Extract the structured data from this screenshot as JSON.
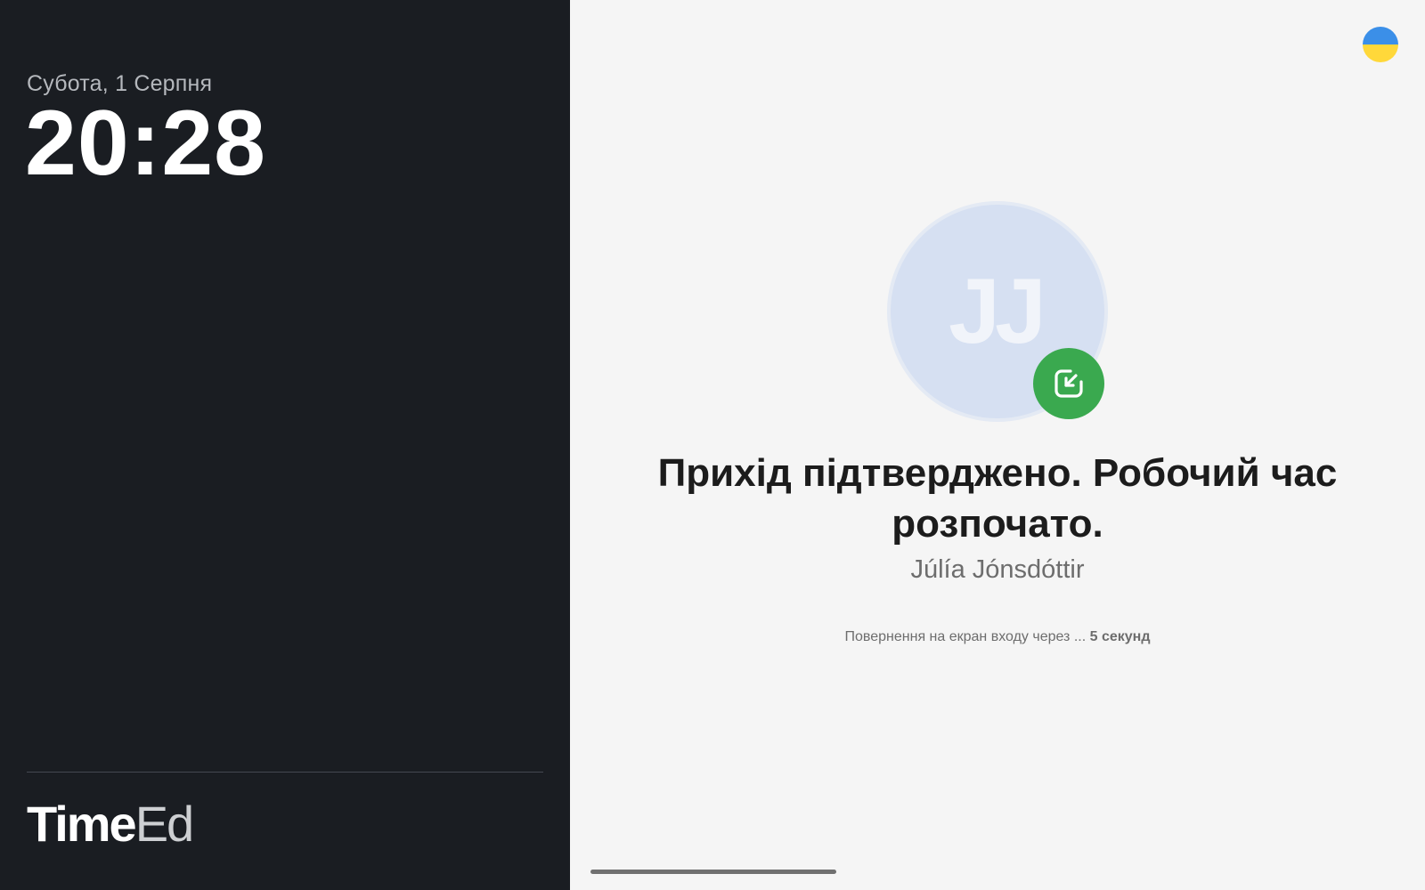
{
  "clock_panel": {
    "date": "Субота, 1 Серпня",
    "time": "20:28",
    "logo_bold": "Time",
    "logo_light": "Ed"
  },
  "language": {
    "flag_icon": "ukraine-flag-icon",
    "colors": {
      "top": "#3b8fe8",
      "bottom": "#ffd83a"
    }
  },
  "confirmation": {
    "avatar_initials": "JJ",
    "badge_icon": "check-in-arrow-icon",
    "badge_color": "#3aa94f",
    "avatar_color": "#d6e0f2",
    "title": "Прихід підтверджено. Робочий час розпочато.",
    "user_name": "Júlía Jónsdóttir",
    "return_text": "Повернення на екран входу через ...",
    "countdown": "5 секунд"
  }
}
